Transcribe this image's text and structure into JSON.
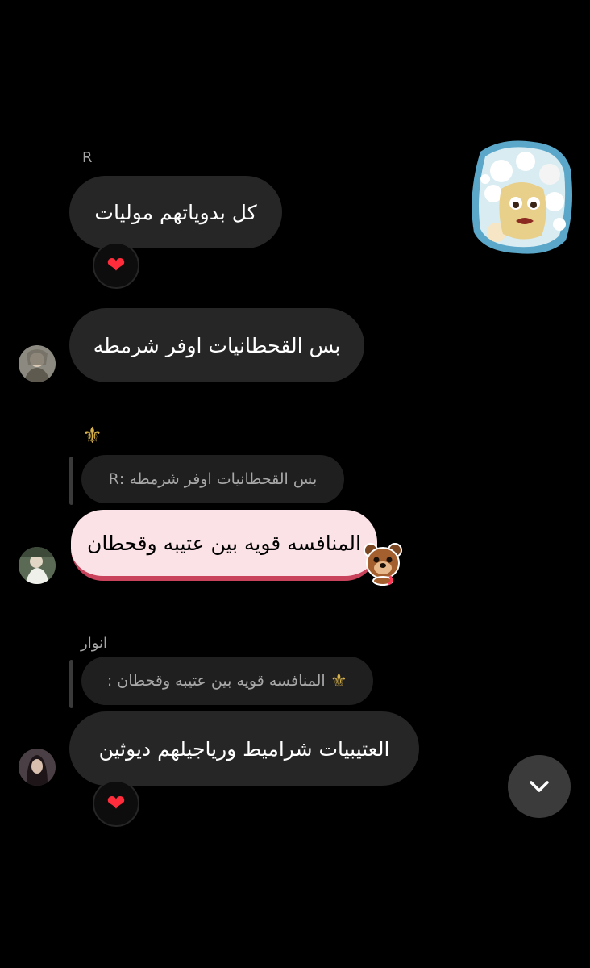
{
  "messages": [
    {
      "sender": "R",
      "text": "كل بدوياتهم موليات",
      "reaction": "❤"
    },
    {
      "text": "بس القحطانيات اوفر شرمطه"
    },
    {
      "sender": "⚜",
      "reply_preview": "بس القحطانيات اوفر شرمطه :R",
      "text": "المنافسه قويه بين عتيبه وقحطان"
    },
    {
      "sender": "انوار",
      "reply_preview": "المنافسه قويه بين عتيبه وقحطان : ",
      "reply_fleur": "⚜",
      "text": "العتيبيات شراميط ورياجيلهم ديوثين",
      "reaction": "❤"
    }
  ],
  "icons": {
    "sticker": "cartoon-face-sticker",
    "bear_sticker": "bear-sticker",
    "scroll_down": "chevron-down-icon"
  },
  "colors": {
    "background": "#000000",
    "bubble": "#262626",
    "highlight_bubble": "#fbe2e6",
    "highlight_border": "#c8435b",
    "fleur": "#d8b24a",
    "heart": "#ff2d3c"
  }
}
